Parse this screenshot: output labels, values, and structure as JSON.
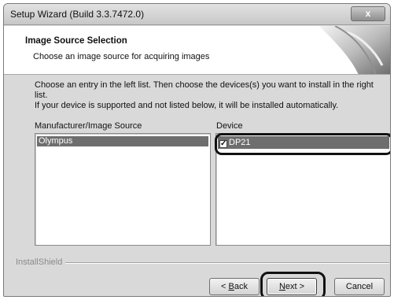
{
  "window": {
    "title": "Setup Wizard (Build 3.3.7472.0)",
    "close_symbol": "x"
  },
  "header": {
    "title": "Image Source Selection",
    "subtitle": "Choose an image source for acquiring images"
  },
  "instructions": {
    "line1": "Choose an entry in the left list. Then choose the devices(s) you want to install in the right list.",
    "line2": "If your device is supported and not listed below, it will be installed automatically."
  },
  "manufacturer_list": {
    "label": "Manufacturer/Image Source",
    "items": [
      "Olympus"
    ],
    "selected": "Olympus"
  },
  "device_list": {
    "label": "Device",
    "items": [
      {
        "name": "DP21",
        "checked": true
      }
    ]
  },
  "branding": "InstallShield",
  "buttons": {
    "back_prefix": "< ",
    "back_accel": "B",
    "back_rest": "ack",
    "next_accel": "N",
    "next_rest": "ext >",
    "cancel": "Cancel"
  }
}
